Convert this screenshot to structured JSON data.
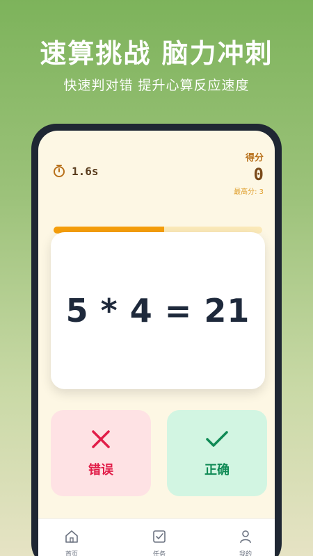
{
  "hero": {
    "title": "速算挑战 脑力冲刺",
    "subtitle": "快速判对错 提升心算反应速度"
  },
  "game": {
    "timer_text": "1.6s",
    "score_label": "得分",
    "score_value": "0",
    "best_label": "最高分: 3",
    "progress_fraction": 0.53,
    "equation": "5 * 4 = 21"
  },
  "answers": {
    "wrong_label": "错误",
    "right_label": "正确"
  },
  "tabs": [
    {
      "label": "首页",
      "icon": "home-icon"
    },
    {
      "label": "任务",
      "icon": "task-checkbox-icon"
    },
    {
      "label": "我的",
      "icon": "person-icon"
    }
  ],
  "colors": {
    "accent_orange": "#f59e0b",
    "wrong_red": "#e11d48",
    "right_green": "#0f8a55"
  }
}
